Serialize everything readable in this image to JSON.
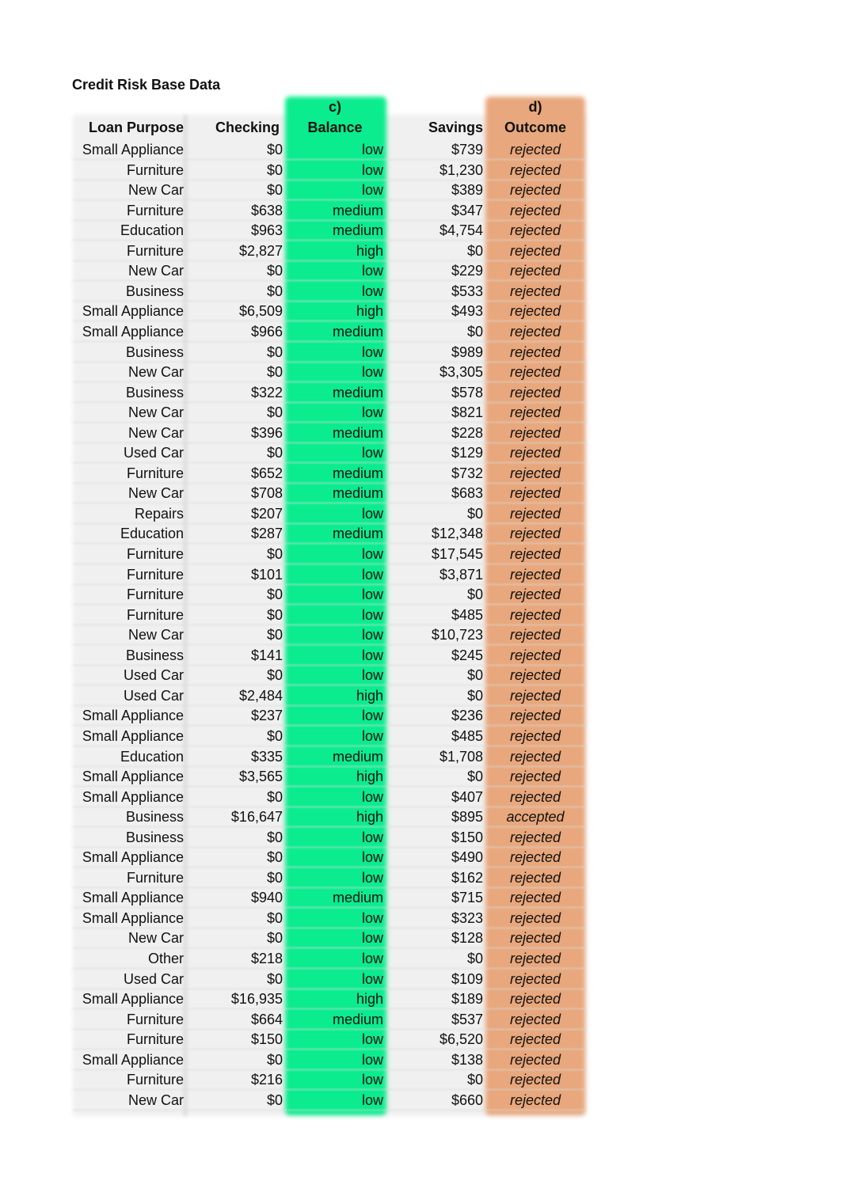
{
  "title": "Credit Risk Base Data",
  "highlight_colors": {
    "balance_column": "#0aec8e",
    "outcome_column": "#e8a77c"
  },
  "annotations": {
    "balance": "c)",
    "outcome": "d)"
  },
  "headers": {
    "loan_purpose": "Loan Purpose",
    "checking": "Checking",
    "balance": "Balance",
    "savings": "Savings",
    "outcome": "Outcome"
  },
  "rows": [
    [
      "Small Appliance",
      "$0",
      "low",
      "$739",
      "rejected"
    ],
    [
      "Furniture",
      "$0",
      "low",
      "$1,230",
      "rejected"
    ],
    [
      "New Car",
      "$0",
      "low",
      "$389",
      "rejected"
    ],
    [
      "Furniture",
      "$638",
      "medium",
      "$347",
      "rejected"
    ],
    [
      "Education",
      "$963",
      "medium",
      "$4,754",
      "rejected"
    ],
    [
      "Furniture",
      "$2,827",
      "high",
      "$0",
      "rejected"
    ],
    [
      "New Car",
      "$0",
      "low",
      "$229",
      "rejected"
    ],
    [
      "Business",
      "$0",
      "low",
      "$533",
      "rejected"
    ],
    [
      "Small Appliance",
      "$6,509",
      "high",
      "$493",
      "rejected"
    ],
    [
      "Small Appliance",
      "$966",
      "medium",
      "$0",
      "rejected"
    ],
    [
      "Business",
      "$0",
      "low",
      "$989",
      "rejected"
    ],
    [
      "New Car",
      "$0",
      "low",
      "$3,305",
      "rejected"
    ],
    [
      "Business",
      "$322",
      "medium",
      "$578",
      "rejected"
    ],
    [
      "New Car",
      "$0",
      "low",
      "$821",
      "rejected"
    ],
    [
      "New Car",
      "$396",
      "medium",
      "$228",
      "rejected"
    ],
    [
      "Used Car",
      "$0",
      "low",
      "$129",
      "rejected"
    ],
    [
      "Furniture",
      "$652",
      "medium",
      "$732",
      "rejected"
    ],
    [
      "New Car",
      "$708",
      "medium",
      "$683",
      "rejected"
    ],
    [
      "Repairs",
      "$207",
      "low",
      "$0",
      "rejected"
    ],
    [
      "Education",
      "$287",
      "medium",
      "$12,348",
      "rejected"
    ],
    [
      "Furniture",
      "$0",
      "low",
      "$17,545",
      "rejected"
    ],
    [
      "Furniture",
      "$101",
      "low",
      "$3,871",
      "rejected"
    ],
    [
      "Furniture",
      "$0",
      "low",
      "$0",
      "rejected"
    ],
    [
      "Furniture",
      "$0",
      "low",
      "$485",
      "rejected"
    ],
    [
      "New Car",
      "$0",
      "low",
      "$10,723",
      "rejected"
    ],
    [
      "Business",
      "$141",
      "low",
      "$245",
      "rejected"
    ],
    [
      "Used Car",
      "$0",
      "low",
      "$0",
      "rejected"
    ],
    [
      "Used Car",
      "$2,484",
      "high",
      "$0",
      "rejected"
    ],
    [
      "Small Appliance",
      "$237",
      "low",
      "$236",
      "rejected"
    ],
    [
      "Small Appliance",
      "$0",
      "low",
      "$485",
      "rejected"
    ],
    [
      "Education",
      "$335",
      "medium",
      "$1,708",
      "rejected"
    ],
    [
      "Small Appliance",
      "$3,565",
      "high",
      "$0",
      "rejected"
    ],
    [
      "Small Appliance",
      "$0",
      "low",
      "$407",
      "rejected"
    ],
    [
      "Business",
      "$16,647",
      "high",
      "$895",
      "accepted"
    ],
    [
      "Business",
      "$0",
      "low",
      "$150",
      "rejected"
    ],
    [
      "Small Appliance",
      "$0",
      "low",
      "$490",
      "rejected"
    ],
    [
      "Furniture",
      "$0",
      "low",
      "$162",
      "rejected"
    ],
    [
      "Small Appliance",
      "$940",
      "medium",
      "$715",
      "rejected"
    ],
    [
      "Small Appliance",
      "$0",
      "low",
      "$323",
      "rejected"
    ],
    [
      "New Car",
      "$0",
      "low",
      "$128",
      "rejected"
    ],
    [
      "Other",
      "$218",
      "low",
      "$0",
      "rejected"
    ],
    [
      "Used Car",
      "$0",
      "low",
      "$109",
      "rejected"
    ],
    [
      "Small Appliance",
      "$16,935",
      "high",
      "$189",
      "rejected"
    ],
    [
      "Furniture",
      "$664",
      "medium",
      "$537",
      "rejected"
    ],
    [
      "Furniture",
      "$150",
      "low",
      "$6,520",
      "rejected"
    ],
    [
      "Small Appliance",
      "$0",
      "low",
      "$138",
      "rejected"
    ],
    [
      "Furniture",
      "$216",
      "low",
      "$0",
      "rejected"
    ],
    [
      "New Car",
      "$0",
      "low",
      "$660",
      "rejected"
    ]
  ]
}
